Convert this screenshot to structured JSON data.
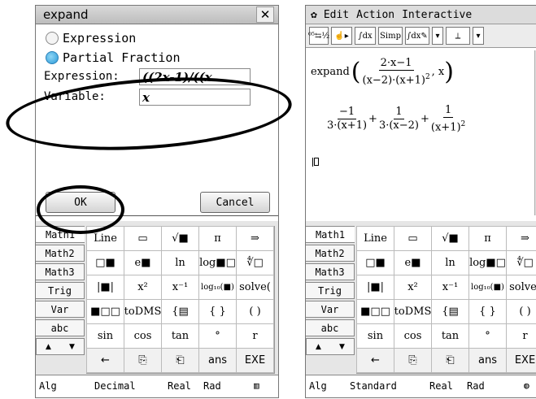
{
  "left": {
    "dialog": {
      "title": "expand",
      "close_label": "✕",
      "radio_expression": "Expression",
      "radio_partial": "Partial Fraction",
      "expression_label": "Expression:",
      "expression_value": "((2x-1)/((x",
      "variable_label": "Variable:",
      "variable_value": "x",
      "ok_label": "OK",
      "cancel_label": "Cancel"
    },
    "tabs": [
      "Math1",
      "Math2",
      "Math3",
      "Trig",
      "Var",
      "abc"
    ],
    "status": {
      "mode": "Alg",
      "format": "Decimal",
      "complex": "Real",
      "angle": "Rad"
    }
  },
  "right": {
    "menu": {
      "edit": "Edit",
      "action": "Action",
      "interactive": "Interactive"
    },
    "toolbar": {
      "simp": "Simp"
    },
    "tabs": [
      "Math1",
      "Math2",
      "Math3",
      "Trig",
      "Var",
      "abc"
    ],
    "status": {
      "mode": "Alg",
      "format": "Standard",
      "complex": "Real",
      "angle": "Rad"
    },
    "work": {
      "input_cmd": "expand",
      "input_num": "2·x−1",
      "input_den": "(x−2)·(x+1)",
      "input_tail": ", x",
      "t1_num": "−1",
      "t1_den": "3·(x+1)",
      "t2_num": "1",
      "t2_den": "3·(x−2)",
      "t3_num": "1",
      "t3_den": "(x+1)",
      "plus": "+",
      "exp": "2"
    }
  },
  "keyboard": {
    "rows": [
      [
        "Line",
        "▭",
        "√■",
        "π",
        "⇒"
      ],
      [
        "□■",
        "e■",
        "ln",
        "log■□",
        "∜□"
      ],
      [
        "|■|",
        "x²",
        "x⁻¹",
        "log₁₀(■)",
        "solve("
      ],
      [
        "■□□",
        "toDMS",
        "{▤",
        "{ }",
        "( )"
      ],
      [
        "sin",
        "cos",
        "tan",
        "°",
        "r"
      ],
      [
        "←",
        "⎘",
        "⎗",
        "ans",
        "EXE"
      ]
    ]
  }
}
